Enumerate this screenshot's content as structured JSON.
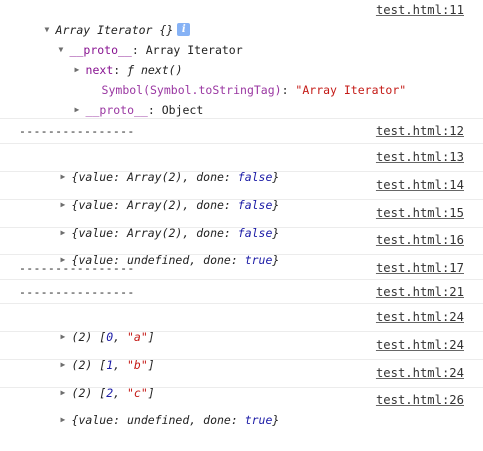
{
  "entries": [
    {
      "type": "expanded_object",
      "source": "test.html:11",
      "title": "Array Iterator {}",
      "proto_label": "__proto__",
      "proto_type": "Array Iterator",
      "next_key": "next",
      "next_value": "ƒ next()",
      "symbol_key": "Symbol(Symbol.toStringTag)",
      "symbol_value": "\"Array Iterator\"",
      "inner_proto_key": "__proto__",
      "inner_proto_value": "Object"
    },
    {
      "type": "text",
      "source": "test.html:12",
      "text": "----------------"
    },
    {
      "type": "result",
      "source": "test.html:13",
      "value": "Array(2)",
      "done": "false"
    },
    {
      "type": "result",
      "source": "test.html:14",
      "value": "Array(2)",
      "done": "false"
    },
    {
      "type": "result",
      "source": "test.html:15",
      "value": "Array(2)",
      "done": "false"
    },
    {
      "type": "result",
      "source": "test.html:16",
      "value": "undefined",
      "done": "true"
    },
    {
      "type": "text",
      "source": "test.html:17",
      "text": "----------------"
    },
    {
      "type": "text",
      "source": "test.html:21",
      "text": "----------------"
    },
    {
      "type": "array",
      "source": "test.html:24",
      "count": "(2)",
      "index": "0",
      "letter": "\"a\""
    },
    {
      "type": "array",
      "source": "test.html:24",
      "count": "(2)",
      "index": "1",
      "letter": "\"b\""
    },
    {
      "type": "array",
      "source": "test.html:24",
      "count": "(2)",
      "index": "2",
      "letter": "\"c\""
    },
    {
      "type": "result",
      "source": "test.html:26",
      "value": "undefined",
      "done": "true"
    }
  ],
  "labels": {
    "value_key": "value",
    "done_key": "done"
  },
  "icons": {
    "expanded": "triangle-down-icon",
    "collapsed": "triangle-right-icon",
    "info": "info-icon"
  },
  "colors": {
    "keyword": "#881391",
    "boolean": "#1a1aa6",
    "string": "#c41a16",
    "info_badge": "#86b2f5"
  }
}
